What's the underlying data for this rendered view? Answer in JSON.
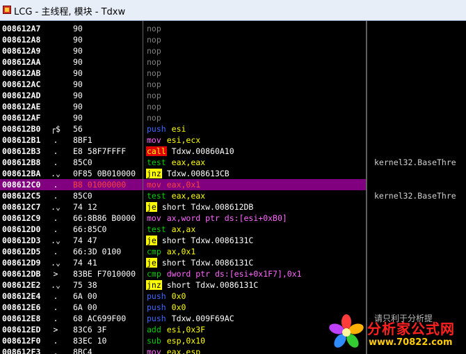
{
  "window": {
    "title": "LCG - 主线程, 模块 - Tdxw"
  },
  "rows": [
    {
      "addr": "008612A7",
      "marker": "",
      "hex": "90",
      "mnem": "nop",
      "mclass": "nop",
      "ops": "",
      "oclass": "plain"
    },
    {
      "addr": "008612A8",
      "marker": "",
      "hex": "90",
      "mnem": "nop",
      "mclass": "nop",
      "ops": "",
      "oclass": "plain"
    },
    {
      "addr": "008612A9",
      "marker": "",
      "hex": "90",
      "mnem": "nop",
      "mclass": "nop",
      "ops": "",
      "oclass": "plain"
    },
    {
      "addr": "008612AA",
      "marker": "",
      "hex": "90",
      "mnem": "nop",
      "mclass": "nop",
      "ops": "",
      "oclass": "plain"
    },
    {
      "addr": "008612AB",
      "marker": "",
      "hex": "90",
      "mnem": "nop",
      "mclass": "nop",
      "ops": "",
      "oclass": "plain"
    },
    {
      "addr": "008612AC",
      "marker": "",
      "hex": "90",
      "mnem": "nop",
      "mclass": "nop",
      "ops": "",
      "oclass": "plain"
    },
    {
      "addr": "008612AD",
      "marker": "",
      "hex": "90",
      "mnem": "nop",
      "mclass": "nop",
      "ops": "",
      "oclass": "plain"
    },
    {
      "addr": "008612AE",
      "marker": "",
      "hex": "90",
      "mnem": "nop",
      "mclass": "nop",
      "ops": "",
      "oclass": "plain"
    },
    {
      "addr": "008612AF",
      "marker": "",
      "hex": "90",
      "mnem": "nop",
      "mclass": "nop",
      "ops": "",
      "oclass": "plain"
    },
    {
      "addr": "008612B0",
      "marker": "┌$",
      "hex": "56",
      "mnem": "push",
      "mclass": "push",
      "ops": "esi",
      "oclass": "reg"
    },
    {
      "addr": "008612B1",
      "marker": ".",
      "hex": "8BF1",
      "mnem": "mov",
      "mclass": "mov",
      "ops": "esi,ecx",
      "oclass": "reg"
    },
    {
      "addr": "008612B3",
      "marker": ".",
      "hex": "E8 58F7FFFF",
      "mnem": "call",
      "mclass": "call",
      "ops": "Tdxw.00860A10",
      "oclass": "plain"
    },
    {
      "addr": "008612B8",
      "marker": ".",
      "hex": "85C0",
      "mnem": "test",
      "mclass": "test",
      "ops": "eax,eax",
      "oclass": "reg"
    },
    {
      "addr": "008612BA",
      "marker": ".⌄",
      "hex": "0F85 0B010000",
      "mnem": "jnz",
      "mclass": "jmp",
      "ops": "Tdxw.008613CB",
      "oclass": "plain"
    },
    {
      "addr": "008612C0",
      "marker": ".",
      "hex": "B8 01000000",
      "mnem": "mov",
      "mclass": "mov",
      "ops": "eax,0x1",
      "oclass": "reg",
      "selected": true
    },
    {
      "addr": "008612C5",
      "marker": ".",
      "hex": "85C0",
      "mnem": "test",
      "mclass": "test",
      "ops": "eax,eax",
      "oclass": "reg"
    },
    {
      "addr": "008612C7",
      "marker": ".⌄",
      "hex": "74 12",
      "mnem": "je",
      "mclass": "jmp",
      "ops": "short Tdxw.008612DB",
      "oclass": "plain"
    },
    {
      "addr": "008612C9",
      "marker": ".",
      "hex": "66:8B86 B0000",
      "mnem": "mov",
      "mclass": "mov",
      "ops": "ax,word ptr ds:[esi+0xB0]",
      "oclass": "mem"
    },
    {
      "addr": "008612D0",
      "marker": ".",
      "hex": "66:85C0",
      "mnem": "test",
      "mclass": "test",
      "ops": "ax,ax",
      "oclass": "reg"
    },
    {
      "addr": "008612D3",
      "marker": ".⌄",
      "hex": "74 47",
      "mnem": "je",
      "mclass": "jmp",
      "ops": "short Tdxw.0086131C",
      "oclass": "plain"
    },
    {
      "addr": "008612D5",
      "marker": ".",
      "hex": "66:3D 0100",
      "mnem": "cmp",
      "mclass": "cmp",
      "ops": "ax,0x1",
      "oclass": "reg"
    },
    {
      "addr": "008612D9",
      "marker": ".⌄",
      "hex": "74 41",
      "mnem": "je",
      "mclass": "jmp",
      "ops": "short Tdxw.0086131C",
      "oclass": "plain"
    },
    {
      "addr": "008612DB",
      "marker": ">",
      "hex": "83BE F7010000",
      "mnem": "cmp",
      "mclass": "cmp",
      "ops": "dword ptr ds:[esi+0x1F7],0x1",
      "oclass": "mem"
    },
    {
      "addr": "008612E2",
      "marker": ".⌄",
      "hex": "75 38",
      "mnem": "jnz",
      "mclass": "jmp",
      "ops": "short Tdxw.0086131C",
      "oclass": "plain"
    },
    {
      "addr": "008612E4",
      "marker": ".",
      "hex": "6A 00",
      "mnem": "push",
      "mclass": "push",
      "ops": "0x0",
      "oclass": "num"
    },
    {
      "addr": "008612E6",
      "marker": ".",
      "hex": "6A 00",
      "mnem": "push",
      "mclass": "push",
      "ops": "0x0",
      "oclass": "num"
    },
    {
      "addr": "008612E8",
      "marker": ".",
      "hex": "68 AC699F00",
      "mnem": "push",
      "mclass": "push",
      "ops": "Tdxw.009F69AC",
      "oclass": "plain"
    },
    {
      "addr": "008612ED",
      "marker": ">",
      "hex": "83C6 3F",
      "mnem": "add",
      "mclass": "add",
      "ops": "esi,0x3F",
      "oclass": "reg"
    },
    {
      "addr": "008612F0",
      "marker": ".",
      "hex": "83EC 10",
      "mnem": "sub",
      "mclass": "sub",
      "ops": "esp,0x10",
      "oclass": "reg"
    },
    {
      "addr": "008612F3",
      "marker": ".",
      "hex": "8BC4",
      "mnem": "mov",
      "mclass": "mov",
      "ops": "eax,esp",
      "oclass": "reg"
    }
  ],
  "comments": [
    {
      "row": 12,
      "text": "kernel32.BaseThre",
      "cjk": false
    },
    {
      "row": 15,
      "text": "kernel32.BaseThre",
      "cjk": false
    },
    {
      "row": 26,
      "text": "请只利于分析提",
      "cjk": true
    }
  ],
  "watermark": {
    "name": "分析家公式网",
    "url": "www.70822.com"
  }
}
